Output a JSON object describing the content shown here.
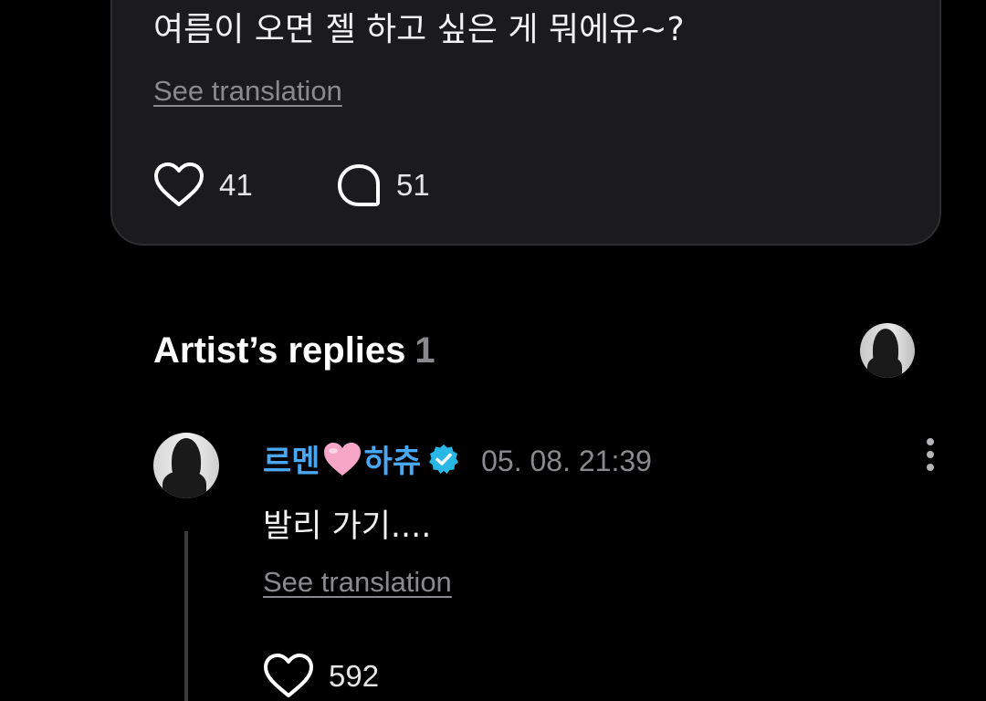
{
  "post": {
    "text": "여름이 오면 젤 하고 싶은 게 뭐에유~?",
    "translate_label": "See translation",
    "like_count": "41",
    "comment_count": "51"
  },
  "artist_replies": {
    "title": "Artist’s replies",
    "count": "1"
  },
  "reply": {
    "author_part1": "르멘",
    "author_part2": "하츄",
    "timestamp": "05. 08. 21:39",
    "text": "발리 가기....",
    "translate_label": "See translation",
    "like_count": "592"
  },
  "colors": {
    "background": "#000000",
    "card": "#1b1b1d",
    "author_name": "#4aa7f2",
    "verified_badge": "#29b8e6",
    "muted_text": "#8a8a8e"
  },
  "icons": [
    "heart-icon",
    "comment-bubble-icon",
    "verified-badge-icon",
    "pink-heart-emoji-icon",
    "more-vertical-icon"
  ]
}
